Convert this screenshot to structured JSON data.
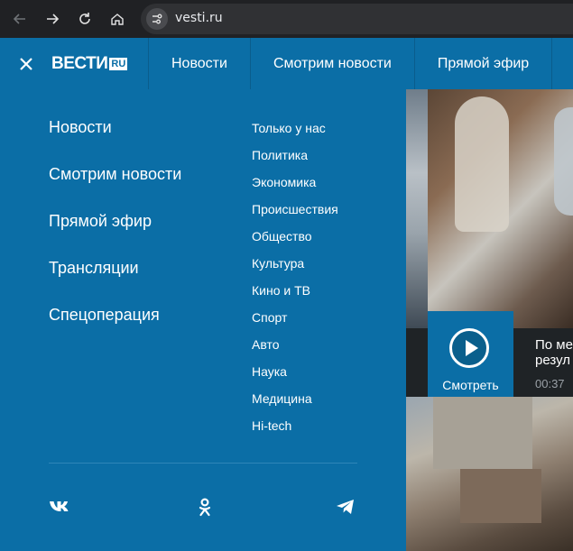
{
  "browser": {
    "url": "vesti.ru",
    "icons": [
      "back-arrow-icon",
      "forward-arrow-icon",
      "reload-icon",
      "home-icon",
      "site-info-icon"
    ]
  },
  "header": {
    "logo_text": "ВЕСТИ",
    "logo_badge": "RU",
    "nav": [
      "Новости",
      "Смотрим новости",
      "Прямой эфир"
    ]
  },
  "menu": {
    "main_links": [
      "Новости",
      "Смотрим новости",
      "Прямой эфир",
      "Трансляции",
      "Спецоперация"
    ],
    "sub_links": [
      "Только у нас",
      "Политика",
      "Экономика",
      "Происшествия",
      "Общество",
      "Культура",
      "Кино и ТВ",
      "Спорт",
      "Авто",
      "Наука",
      "Медицина",
      "Hi-tech"
    ],
    "social_icons": [
      "vk-icon",
      "odnoklassniki-icon",
      "telegram-icon"
    ]
  },
  "content": {
    "watch_label": "Смотреть",
    "news_title_line1": "По ме",
    "news_title_line2": "резул",
    "news_time": "00:37"
  },
  "colors": {
    "brand_blue": "#0b6ea6",
    "chrome_dark": "#202124"
  }
}
